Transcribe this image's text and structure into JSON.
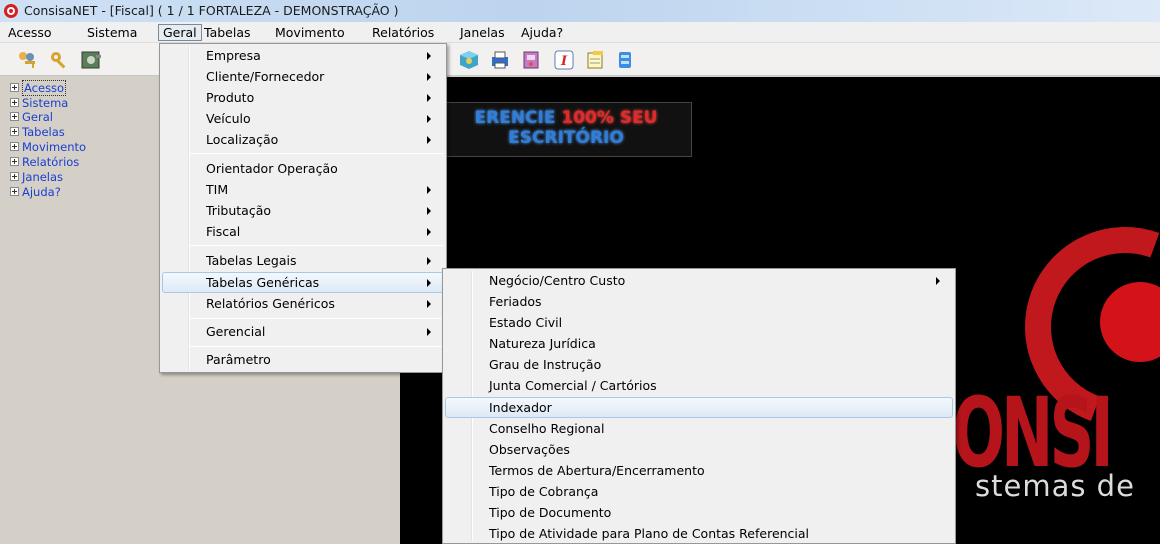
{
  "window": {
    "title": "ConsisaNET - [Fiscal] ( 1 / 1 FORTALEZA - DEMONSTRAÇÃO )"
  },
  "menubar": {
    "items": [
      "Acesso",
      "Sistema",
      "Geral",
      "Tabelas",
      "Movimento",
      "Relatórios",
      "Janelas",
      "Ajuda?"
    ],
    "active": "Geral"
  },
  "toolbar": {
    "icons": [
      "users-key-icon",
      "key-icon",
      "safe-icon",
      "package-icon",
      "printer-icon",
      "book-icon",
      "text-italic-icon",
      "notepad-icon",
      "database-icon"
    ]
  },
  "tree": {
    "items": [
      "Acesso",
      "Sistema",
      "Geral",
      "Tabelas",
      "Movimento",
      "Relatórios",
      "Janelas",
      "Ajuda?"
    ],
    "selected": "Acesso"
  },
  "background": {
    "banner_line1_a": "ERENCIE ",
    "banner_line1_b": "100% SEU",
    "banner_line2": "ESCRITÓRIO",
    "brand_big": "ONSI",
    "brand_sub": "stemas de"
  },
  "geral_menu": {
    "items": [
      {
        "label": "Empresa",
        "submenu": true
      },
      {
        "label": "Cliente/Fornecedor",
        "submenu": true
      },
      {
        "label": "Produto",
        "submenu": true
      },
      {
        "label": "Veículo",
        "submenu": true
      },
      {
        "label": "Localização",
        "submenu": true
      },
      {
        "label": "Orientador Operação",
        "submenu": false
      },
      {
        "label": "TIM",
        "submenu": true
      },
      {
        "label": "Tributação",
        "submenu": true
      },
      {
        "label": "Fiscal",
        "submenu": true
      },
      {
        "label": "Tabelas Legais",
        "submenu": true
      },
      {
        "label": "Tabelas Genéricas",
        "submenu": true
      },
      {
        "label": "Relatórios Genéricos",
        "submenu": true
      },
      {
        "label": "Gerencial",
        "submenu": true
      },
      {
        "label": "Parâmetro",
        "submenu": false
      }
    ],
    "highlighted": "Tabelas Genéricas"
  },
  "tabelas_genericas_menu": {
    "items": [
      {
        "label": "Negócio/Centro Custo",
        "submenu": true
      },
      {
        "label": "Feriados",
        "submenu": false
      },
      {
        "label": "Estado Civil",
        "submenu": false
      },
      {
        "label": "Natureza Jurídica",
        "submenu": false
      },
      {
        "label": "Grau de Instrução",
        "submenu": false
      },
      {
        "label": "Junta Comercial / Cartórios",
        "submenu": false
      },
      {
        "label": "Indexador",
        "submenu": false
      },
      {
        "label": "Conselho Regional",
        "submenu": false
      },
      {
        "label": "Observações",
        "submenu": false
      },
      {
        "label": "Termos de Abertura/Encerramento",
        "submenu": false
      },
      {
        "label": "Tipo de Cobrança",
        "submenu": false
      },
      {
        "label": "Tipo de Documento",
        "submenu": false
      },
      {
        "label": "Tipo de Atividade para Plano de Contas Referencial",
        "submenu": false
      }
    ],
    "highlighted": "Indexador"
  },
  "colors": {
    "tree_link": "#1a3ecf",
    "canvas_bg": "#000000",
    "brand_red": "#c0181c",
    "highlight_border": "#a8c8ea"
  }
}
